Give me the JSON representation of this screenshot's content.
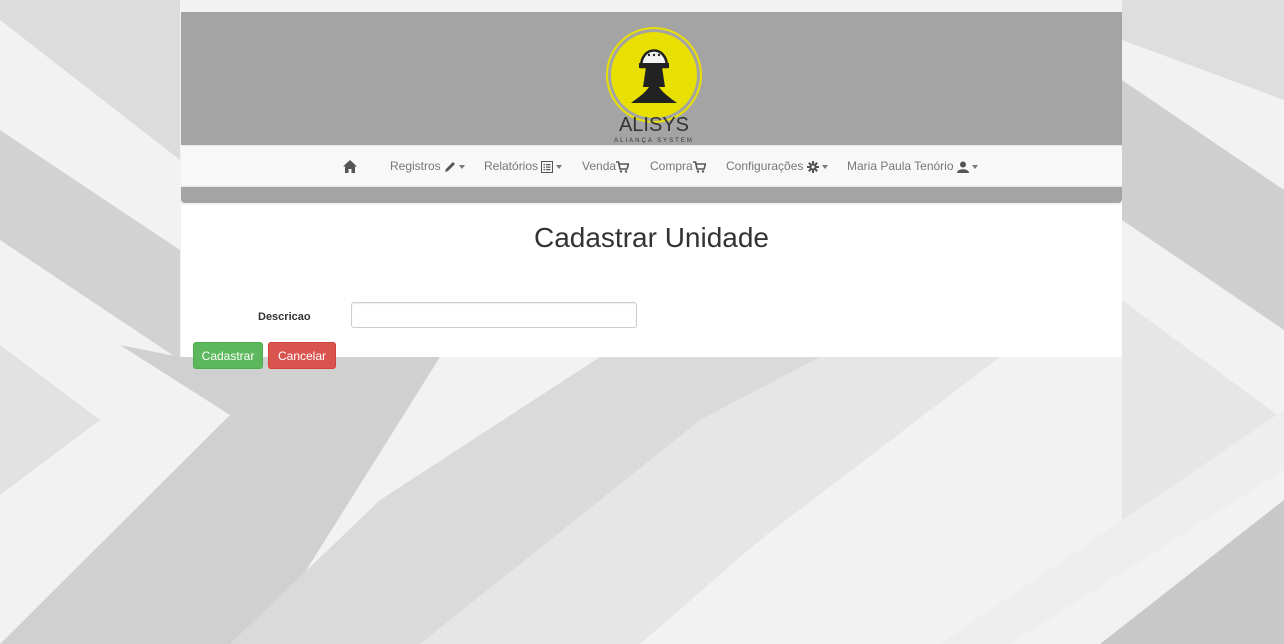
{
  "brand": {
    "name": "ALISYS",
    "tagline": "ALIANÇA SYSTEM",
    "accent_color": "#e8e000"
  },
  "nav": {
    "home_icon": "home-icon",
    "items": [
      {
        "label": "Registros",
        "icon": "pencil-icon",
        "dropdown": true
      },
      {
        "label": "Relatórios",
        "icon": "list-alt-icon",
        "dropdown": true
      },
      {
        "label": "Venda",
        "icon": "shopping-cart-icon",
        "dropdown": false
      },
      {
        "label": "Compra",
        "icon": "shopping-cart-icon",
        "dropdown": false
      },
      {
        "label": "Configurações",
        "icon": "cog-icon",
        "dropdown": true
      },
      {
        "label": "Maria Paula Tenório",
        "icon": "user-icon",
        "dropdown": true
      }
    ]
  },
  "page": {
    "title": "Cadastrar Unidade"
  },
  "form": {
    "descricao_label": "Descricao",
    "descricao_value": "",
    "submit_label": "Cadastrar",
    "cancel_label": "Cancelar"
  },
  "colors": {
    "header_bg": "#a4a4a4",
    "success": "#5cb85c",
    "danger": "#d9534f"
  }
}
